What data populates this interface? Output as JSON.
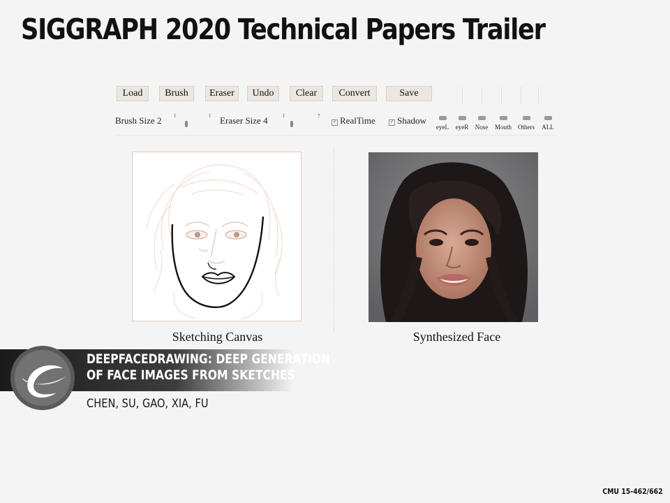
{
  "slide": {
    "title": "SIGGRAPH 2020 Technical Papers Trailer",
    "course": "CMU 15-462/662"
  },
  "toolbar": {
    "buttons": [
      "Load",
      "Brush",
      "Eraser",
      "Undo",
      "Clear",
      "Convert",
      "Save"
    ],
    "brush_size_label": "Brush Size 2",
    "eraser_size_label": "Eraser Size 4",
    "realtime_label": "RealTime",
    "shadow_label": "Shadow",
    "realtime_checked": true,
    "shadow_checked": true,
    "slider_ticks": [
      "1",
      "1",
      "1",
      "7"
    ],
    "regions": [
      "eyeL",
      "eyeR",
      "Nose",
      "Mouth",
      "Others",
      "ALL"
    ]
  },
  "panels": {
    "sketch_caption": "Sketching Canvas",
    "face_caption": "Synthesized Face"
  },
  "paper": {
    "title_line1": "DEEPFACEDRAWING: DEEP GENERATION",
    "title_line2": "OF FACE IMAGES FROM SKETCHES",
    "authors": "CHEN, SU, GAO, XIA, FU"
  },
  "colors": {
    "background": "#f4f4f4",
    "button_bg": "#ece6e0",
    "banner": "#2a2a2a",
    "logo_ring": "#5a5a5a"
  },
  "icons": {
    "logo": "siggraph-logo-icon"
  }
}
